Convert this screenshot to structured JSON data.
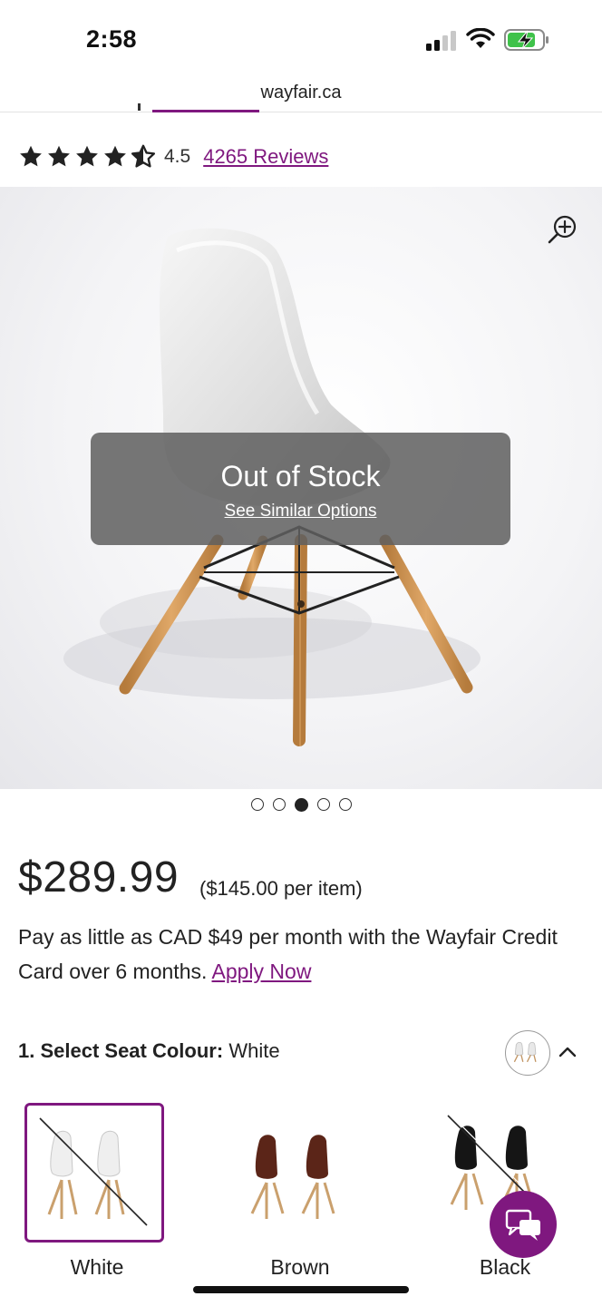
{
  "status_bar": {
    "time": "2:58"
  },
  "browser": {
    "url": "wayfair.ca"
  },
  "rating": {
    "value": "4.5",
    "reviews_text": "4265 Reviews",
    "stars_filled": 4.5,
    "stars_total": 5
  },
  "gallery": {
    "overlay_title": "Out of Stock",
    "overlay_link": "See Similar Options",
    "image_count": 5,
    "active_index": 2
  },
  "pricing": {
    "price": "$289.99",
    "per_item": "($145.00 per item)",
    "financing_text": "Pay as little as CAD $49 per month with the Wayfair Credit Card over 6 months.",
    "apply_link": "Apply Now"
  },
  "options": {
    "header_label": "1. Select Seat Colour:",
    "header_value": "White",
    "items": [
      {
        "label": "White",
        "selected": true,
        "unavailable": true
      },
      {
        "label": "Brown",
        "selected": false,
        "unavailable": false
      },
      {
        "label": "Black",
        "selected": false,
        "unavailable": true
      }
    ]
  },
  "colors": {
    "brand_purple": "#7f187f",
    "overlay_gray": "#606060"
  },
  "icons": [
    "star-icon",
    "zoom-in-icon",
    "chevron-up-icon",
    "chat-icon",
    "signal-icon",
    "wifi-icon",
    "battery-charging-icon"
  ]
}
